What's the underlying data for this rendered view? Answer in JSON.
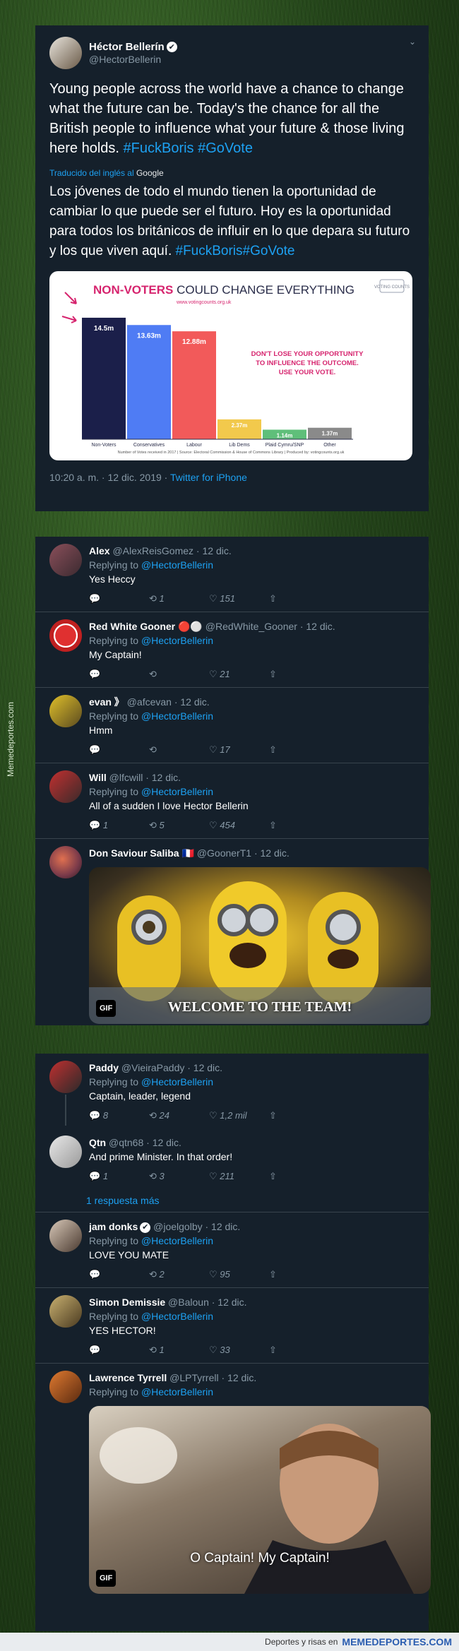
{
  "main_tweet": {
    "name": "Héctor Bellerín",
    "handle": "@HectorBellerin",
    "text_plain": "Young people across the world have a chance to change what the future can be. Today's the chance for all the British people to influence what your future & those living here holds.",
    "hashtags": "#FuckBoris #GoVote",
    "translated_label": "Traducido del inglés al",
    "translated_by": "Google",
    "translation_plain": "Los jóvenes de todo el mundo tienen la oportunidad de cambiar lo que puede ser el futuro. Hoy es la oportunidad para todos los británicos de influir en lo que depara su futuro y los que viven aquí.",
    "translation_hashtags": "#FuckBoris#GoVote",
    "timestamp": "10:20 a. m. · 12 dic. 2019 ·",
    "source": "Twitter for iPhone"
  },
  "chart_data": {
    "type": "bar",
    "title_bold": "NON-VOTERS",
    "title_rest": "COULD CHANGE EVERYTHING",
    "subtitle_url": "www.votingcounts.org.uk",
    "logo": "VOTING COUNTS",
    "callout": [
      "DON'T LOSE YOUR OPPORTUNITY",
      "TO INFLUENCE THE OUTCOME.",
      "USE YOUR VOTE."
    ],
    "categories": [
      "Non-Voters",
      "Conservatives",
      "Labour",
      "Lib Dems",
      "Plaid Cymru/SNP",
      "Other"
    ],
    "value_labels": [
      "14.5m",
      "13.63m",
      "12.88m",
      "2.37m",
      "1.14m",
      "1.37m"
    ],
    "values": [
      14.5,
      13.63,
      12.88,
      2.37,
      1.14,
      1.37
    ],
    "colors": [
      "#1b1f4a",
      "#4f7cf4",
      "#f25a5a",
      "#f2c94c",
      "#5fbf7a",
      "#8a8a8a"
    ],
    "ylim": [
      0,
      15
    ],
    "footnote": "Number of Votes received in 2017 | Source: Electoral Commission & House of Commons Library | Produced by: votingcounts.org.uk"
  },
  "replies": [
    {
      "name": "Alex",
      "handle": "@AlexReisGomez · 12 dic.",
      "replying_to": "Replying to",
      "mention": "@HectorBellerin",
      "text": "Yes Heccy",
      "replies": "",
      "retweets": "1",
      "likes": "151"
    },
    {
      "name": "Red White Gooner 🔴⚪",
      "handle": "@RedWhite_Gooner · 12 dic.",
      "replying_to": "Replying to",
      "mention": "@HectorBellerin",
      "text": "My Captain!",
      "replies": "",
      "retweets": "",
      "likes": "21"
    },
    {
      "name": "evan 》",
      "handle": "@afcevan · 12 dic.",
      "replying_to": "Replying to",
      "mention": "@HectorBellerin",
      "text": "Hmm",
      "replies": "",
      "retweets": "",
      "likes": "17"
    },
    {
      "name": "Will",
      "handle": "@lfcwill · 12 dic.",
      "replying_to": "Replying to",
      "mention": "@HectorBellerin",
      "text": "All of a sudden I love Hector Bellerin",
      "replies": "1",
      "retweets": "5",
      "likes": "454"
    },
    {
      "name": "Don Saviour Saliba 🇫🇷",
      "handle": "@GoonerT1 · 12 dic.",
      "gif_caption": "WELCOME TO THE TEAM!",
      "gif_badge": "GIF"
    }
  ],
  "replies2": [
    {
      "name": "Paddy",
      "handle": "@VieiraPaddy · 12 dic.",
      "replying_to": "Replying to",
      "mention": "@HectorBellerin",
      "text": "Captain, leader, legend",
      "replies": "8",
      "retweets": "24",
      "likes": "1,2 mil"
    },
    {
      "name": "Qtn",
      "handle": "@qtn68 · 12 dic.",
      "text": "And prime Minister. In that order!",
      "replies": "1",
      "retweets": "3",
      "likes": "211"
    },
    {
      "more": "1 respuesta más"
    },
    {
      "name": "jam donks",
      "handle": "@joelgolby · 12 dic.",
      "replying_to": "Replying to",
      "mention": "@HectorBellerin",
      "text": "LOVE YOU MATE",
      "replies": "",
      "retweets": "2",
      "likes": "95"
    },
    {
      "name": "Simon Demissie",
      "handle": "@Baloun · 12 dic.",
      "replying_to": "Replying to",
      "mention": "@HectorBellerin",
      "text": "YES HECTOR!",
      "replies": "",
      "retweets": "1",
      "likes": "33"
    },
    {
      "name": "Lawrence Tyrrell",
      "handle": "@LPTyrrell · 12 dic.",
      "replying_to": "Replying to",
      "mention": "@HectorBellerin",
      "gif_caption": "O Captain! My Captain!",
      "gif_badge": "GIF"
    }
  ],
  "watermark": "Memedeportes.com",
  "footer": {
    "small": "Deportes y risas en",
    "brand": "MEMEDEPORTES.COM"
  },
  "colors": {
    "bg_card": "#15202b",
    "link": "#1da1f2",
    "muted": "#8899a6"
  }
}
